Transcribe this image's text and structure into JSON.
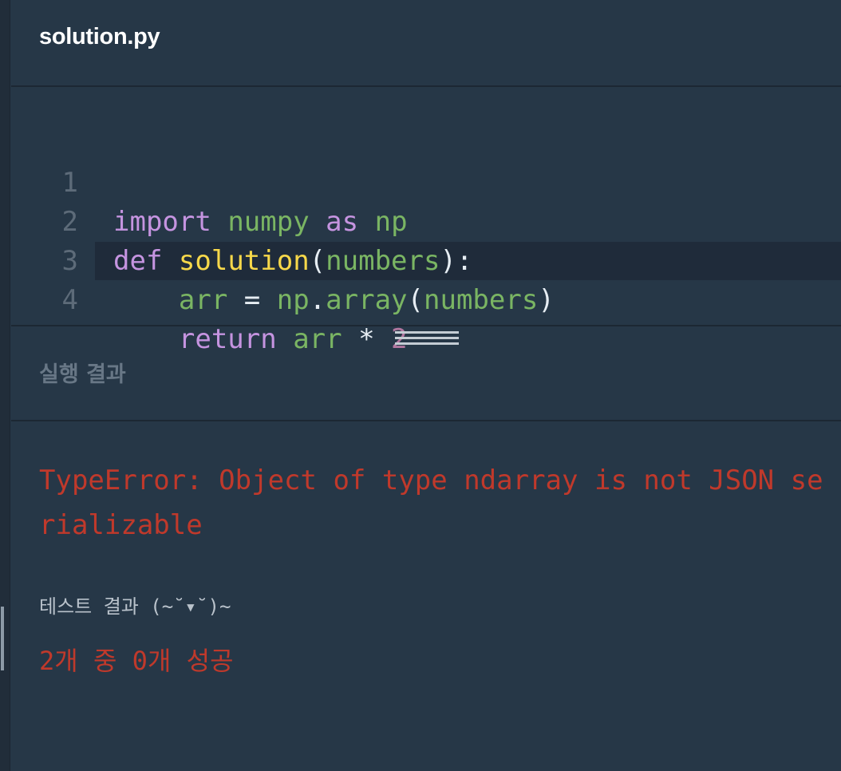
{
  "file": {
    "title": "solution.py"
  },
  "editor": {
    "lines": [
      {
        "number": "1",
        "tokens": [
          "import",
          " ",
          "numpy",
          " ",
          "as",
          " ",
          "np"
        ]
      },
      {
        "number": "2",
        "tokens": [
          "def",
          " ",
          "solution",
          "(",
          "numbers",
          "):"
        ]
      },
      {
        "number": "3",
        "tokens": [
          "    ",
          "arr",
          " = ",
          "np",
          ".",
          "array",
          "(",
          "numbers",
          ")"
        ]
      },
      {
        "number": "4",
        "tokens": [
          "    ",
          "return",
          " ",
          "arr",
          " * ",
          "2"
        ]
      }
    ]
  },
  "result": {
    "title": "실행 결과",
    "error": "TypeError: Object of type ndarray is not JSON serializable",
    "test_label": "테스트 결과 (~˘▾˘)~",
    "test_summary": "2개 중 0개 성공"
  },
  "colors": {
    "background": "#263747",
    "keyword": "#c594e0",
    "identifier": "#7ab563",
    "function": "#f7d84a",
    "number": "#b277a0",
    "error": "#c0392b"
  }
}
